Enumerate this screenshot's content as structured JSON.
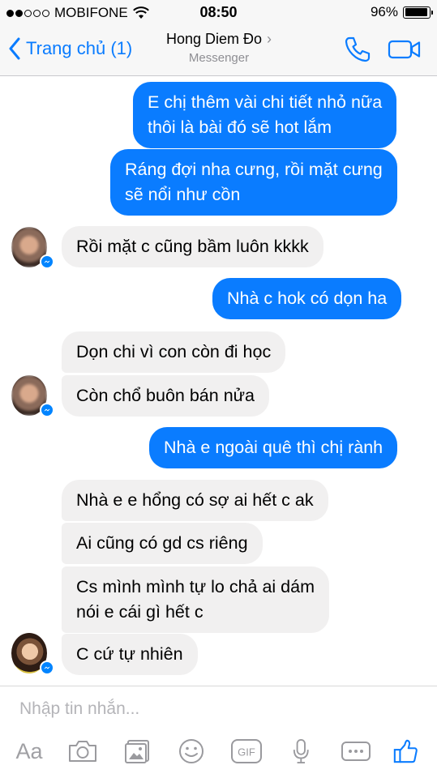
{
  "status_bar": {
    "carrier": "MOBIFONE",
    "time": "08:50",
    "battery_percent": "96%",
    "signal_bars_filled": 2,
    "signal_bars_total": 5
  },
  "nav": {
    "back_label": "Trang chủ (1)",
    "contact_name": "Hong Diem Đo",
    "subtitle": "Messenger",
    "accent_color": "#0a7cff"
  },
  "messages": [
    {
      "id": "m1",
      "sender": "me",
      "lines": [
        "E chị thêm vài chi tiết nhỏ nữa",
        "thôi là bài đó sẽ hot lắm"
      ]
    },
    {
      "id": "m2",
      "sender": "me",
      "lines": [
        "Ráng đợi nha cưng, rồi mặt cưng",
        "sẽ nổi như cồn"
      ]
    },
    {
      "id": "m3",
      "sender": "them",
      "lines": [
        "Rồi mặt c cũng bầm luôn kkkk"
      ]
    },
    {
      "id": "m4",
      "sender": "me",
      "lines": [
        "Nhà c hok có dọn ha"
      ]
    },
    {
      "id": "m5",
      "sender": "them",
      "lines": [
        "Dọn chi vì con còn đi học"
      ]
    },
    {
      "id": "m6",
      "sender": "them",
      "lines": [
        "Còn chổ buôn bán nửa"
      ]
    },
    {
      "id": "m7",
      "sender": "me",
      "lines": [
        "Nhà e ngoài quê thì chị rành"
      ]
    },
    {
      "id": "m8",
      "sender": "them",
      "lines": [
        "Nhà e e hổng có sợ ai hết c ak"
      ]
    },
    {
      "id": "m9",
      "sender": "them",
      "lines": [
        "Ai cũng có gd cs riêng"
      ]
    },
    {
      "id": "m10",
      "sender": "them",
      "lines": [
        "Cs mình mình tự lo chả ai dám",
        "nói e cái gì hết c"
      ]
    },
    {
      "id": "m11",
      "sender": "them",
      "lines": [
        "C cứ tự nhiên"
      ]
    }
  ],
  "composer": {
    "placeholder": "Nhập tin nhắn...",
    "tools": [
      "text-format-icon",
      "camera-icon",
      "photo-gallery-icon",
      "emoji-icon",
      "gif-icon",
      "microphone-icon",
      "more-icon",
      "like-thumb-icon"
    ],
    "text_format_label": "Aa",
    "gif_label": "GIF"
  }
}
